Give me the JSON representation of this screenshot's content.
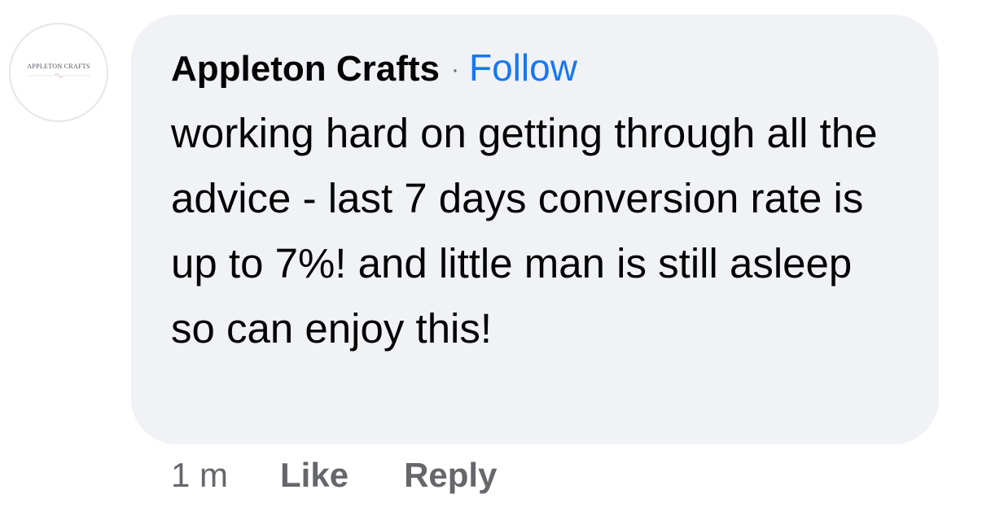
{
  "avatar": {
    "logo_text": "APPLETON CRAFTS"
  },
  "comment": {
    "author": "Appleton Crafts",
    "separator": "·",
    "follow_label": "Follow",
    "text": "working hard on getting through all the advice - last 7 days conversion rate is up to 7%! and little man is still asleep so can enjoy this!"
  },
  "actions": {
    "timestamp": "1 m",
    "like_label": "Like",
    "reply_label": "Reply"
  },
  "colors": {
    "bubble_bg": "#f0f2f5",
    "link_blue": "#1877f2",
    "secondary_text": "#65676b",
    "primary_text": "#050505"
  }
}
